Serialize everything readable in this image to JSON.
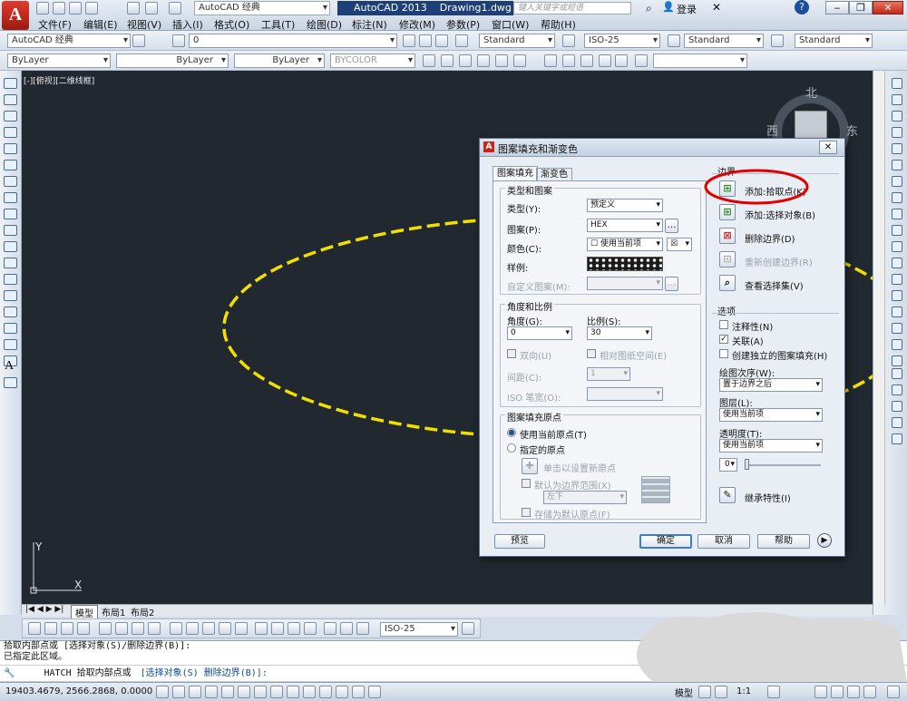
{
  "title_bar": {
    "workspace": "AutoCAD 经典",
    "app": "AutoCAD 2013",
    "file": "Drawing1.dwg",
    "search_placeholder": "键入关键字或短语",
    "login": "登录"
  },
  "menu": [
    "文件(F)",
    "编辑(E)",
    "视图(V)",
    "插入(I)",
    "格式(O)",
    "工具(T)",
    "绘图(D)",
    "标注(N)",
    "修改(M)",
    "参数(P)",
    "窗口(W)",
    "帮助(H)"
  ],
  "toolbar2": {
    "workspace": "AutoCAD 经典",
    "layer": "0",
    "text_style": "Standard",
    "dim_style": "ISO-25",
    "table_style": "Standard",
    "mleader_style": "Standard"
  },
  "toolbar3": {
    "color": "ByLayer",
    "linetype": "ByLayer",
    "lineweight": "ByLayer",
    "plotstyle": "BYCOLOR"
  },
  "viewport_label": "[-][俯视][二维线框]",
  "viewcube": {
    "north": "北",
    "west": "西",
    "east": "东"
  },
  "ucs": {
    "y": "Y",
    "x": "X"
  },
  "layout_tabs": [
    "模型",
    "布局1",
    "布局2"
  ],
  "dim_toolbar_combo": "ISO-25",
  "dialog": {
    "title": "图案填充和渐变色",
    "tabs": [
      "图案填充",
      "渐变色"
    ],
    "type_group": "类型和图案",
    "type_label": "类型(Y):",
    "type_value": "预定义",
    "pattern_label": "图案(P):",
    "pattern_value": "HEX",
    "color_label": "颜色(C):",
    "color_value": "使用当前项",
    "swatch_label": "样例:",
    "custom_label": "自定义图案(M):",
    "angle_group": "角度和比例",
    "angle_label": "角度(G):",
    "angle_value": "0",
    "scale_label": "比例(S):",
    "scale_value": "30",
    "double_label": "双向(U)",
    "relpaper_label": "相对图纸空间(E)",
    "spacing_label": "间距(C):",
    "spacing_value": "1",
    "iso_label": "ISO 笔宽(O):",
    "origin_group": "图案填充原点",
    "origin_current": "使用当前原点(T)",
    "origin_specified": "指定的原点",
    "click_set": "单击以设置新原点",
    "default_ext": "默认为边界范围(X)",
    "corner_value": "左下",
    "store_default": "存储为默认原点(F)",
    "boundary_group": "边界",
    "add_pick": "添加:拾取点(K)",
    "add_select": "添加:选择对象(B)",
    "remove": "删除边界(D)",
    "recreate": "重新创建边界(R)",
    "view_sel": "查看选择集(V)",
    "options_group": "选项",
    "annotative": "注释性(N)",
    "associative": "关联(A)",
    "separate": "创建独立的图案填充(H)",
    "draw_order_label": "绘图次序(W):",
    "draw_order_value": "置于边界之后",
    "layer_label": "图层(L):",
    "layer_value": "使用当前项",
    "transp_label": "透明度(T):",
    "transp_value": "使用当前项",
    "transp_num": "0",
    "inherit": "继承特性(I)",
    "preview": "预览",
    "ok": "确定",
    "cancel": "取消",
    "help": "帮助"
  },
  "command": {
    "line1": "拾取内部点或 [选择对象(S)/删除边界(B)]:",
    "line2": "已指定此区域。",
    "prompt_prefix": "HATCH 拾取内部点或",
    "prompt_opts": "[选择对象(S) 删除边界(B)]:"
  },
  "status": {
    "coords": "19403.4679, 2566.2868, 0.0000",
    "model": "模型",
    "scale": "1:1"
  },
  "colors": {
    "canvas": "#212830",
    "ellipse": "#f0e000",
    "highlight": "#e00000"
  }
}
